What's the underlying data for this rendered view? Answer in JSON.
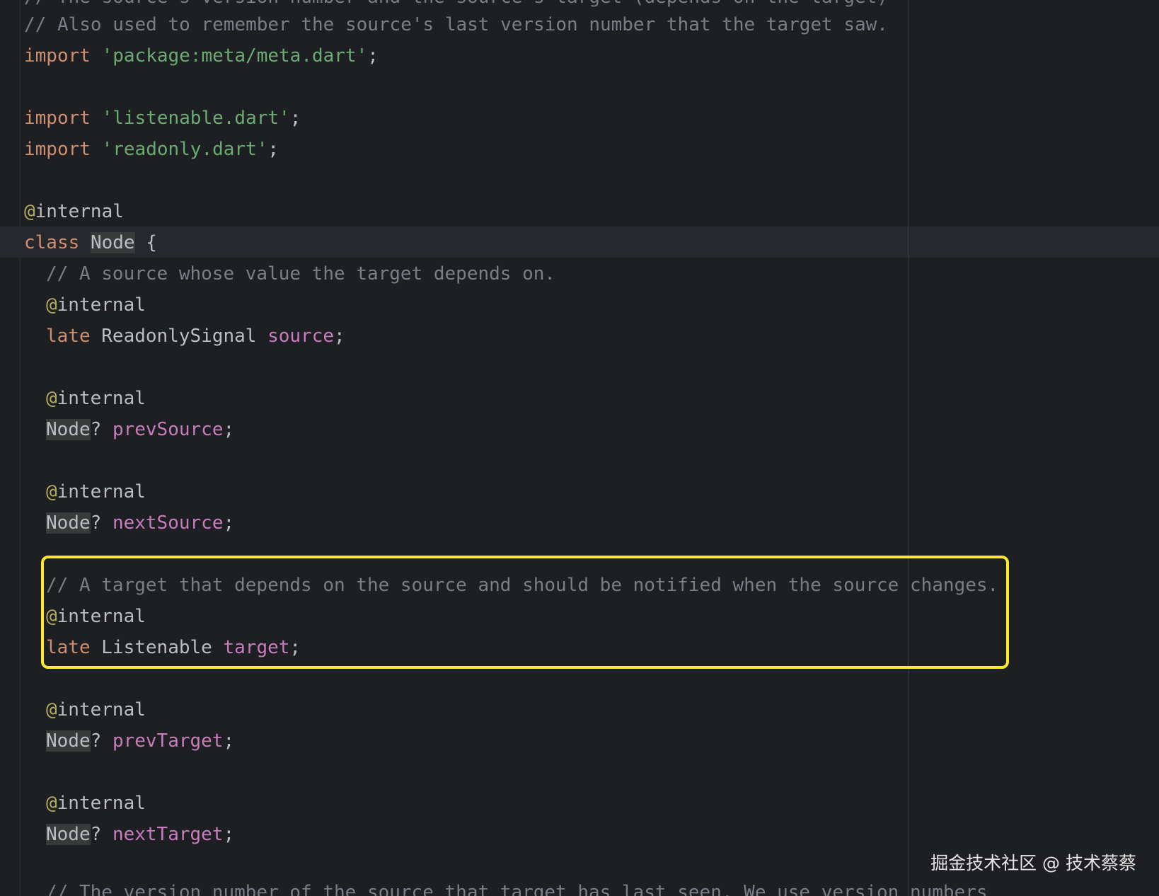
{
  "colors": {
    "background": "#1e1f22",
    "comment": "#7a7e85",
    "keyword": "#cf8e6d",
    "string": "#6aab73",
    "annotation": "#b3ae60",
    "field": "#c77dbb",
    "highlight_box": "#fce82c"
  },
  "code": {
    "line_top_partial": "// The source's version number and the source's target (depends on the target)",
    "line_comment_also": "// Also used to remember the source's last version number that the target saw.",
    "import_kw": "import",
    "import_meta": "'package:meta/meta.dart'",
    "import_listenable": "'listenable.dart'",
    "import_readonly": "'readonly.dart'",
    "semicolon": ";",
    "at": "@",
    "internal": "internal",
    "class_kw": "class",
    "node_type": "Node",
    "open_brace": " {",
    "comment_source": "// A source whose value the target depends on.",
    "late_kw": "late",
    "readonly_signal": "ReadonlySignal",
    "field_source": "source",
    "question": "?",
    "field_prev_source": "prevSource",
    "field_next_source": "nextSource",
    "comment_target": "// A target that depends on the source and should be notified when the source changes.",
    "listenable_type": "Listenable",
    "field_target": "target",
    "field_prev_target": "prevTarget",
    "field_next_target": "nextTarget",
    "comment_version": "// The version number of the source that target has last seen. We use version numbers"
  },
  "watermark": "掘金技术社区 @ 技术蔡蔡"
}
